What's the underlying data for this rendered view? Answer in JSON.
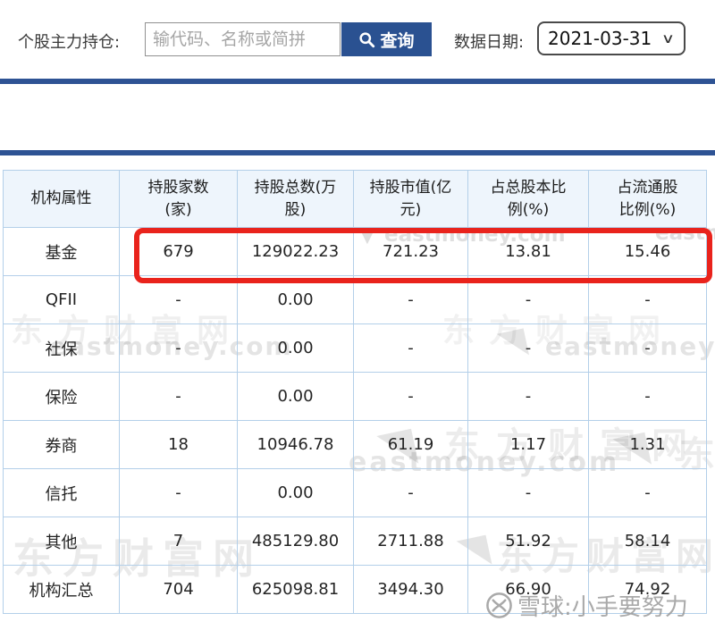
{
  "page": {
    "toolbar": {
      "title_label": "个股主力持仓:",
      "search_placeholder": "输代码、名称或简拼",
      "query_button_label": "查询",
      "date_label": "数据日期:",
      "date_value": "2021-03-31"
    },
    "icons": {
      "chevron_down": "∨",
      "logo_mark": "◥",
      "logo_mark_small": "▼"
    },
    "colors": {
      "navy_bar": "#2e5394",
      "button_bg": "#2a5191",
      "table_border": "#b3cfe9",
      "header_bg": "#eef5fc",
      "highlight_red": "#e9231c",
      "watermark_gray": "#9b9b9b"
    },
    "table": {
      "headers": [
        "机构属性",
        "持股家数\n(家)",
        "持股总数(万\n股)",
        "持股市值(亿\n元)",
        "占总股本比\n例(%)",
        "占流通股\n比例(%)"
      ],
      "rows": [
        {
          "label": "基金",
          "values": [
            "679",
            "129022.23",
            "721.23",
            "13.81",
            "15.46"
          ],
          "highlighted": true
        },
        {
          "label": "QFII",
          "values": [
            "-",
            "0.00",
            "-",
            "-",
            "-"
          ]
        },
        {
          "label": "社保",
          "values": [
            "-",
            "0.00",
            "-",
            "-",
            "-"
          ]
        },
        {
          "label": "保险",
          "values": [
            "-",
            "0.00",
            "-",
            "-",
            "-"
          ]
        },
        {
          "label": "券商",
          "values": [
            "18",
            "10946.78",
            "61.19",
            "1.17",
            "1.31"
          ]
        },
        {
          "label": "信托",
          "values": [
            "-",
            "0.00",
            "-",
            "-",
            "-"
          ]
        },
        {
          "label": "其他",
          "values": [
            "7",
            "485129.80",
            "2711.88",
            "51.92",
            "58.14"
          ]
        },
        {
          "label": "机构汇总",
          "values": [
            "704",
            "625098.81",
            "3494.30",
            "66.90",
            "74.92"
          ]
        }
      ]
    },
    "watermarks": {
      "site_name": "东方财富网",
      "site_domain": "eastmoney.com",
      "xueqiu_label": "雪球:小手要努力"
    }
  }
}
